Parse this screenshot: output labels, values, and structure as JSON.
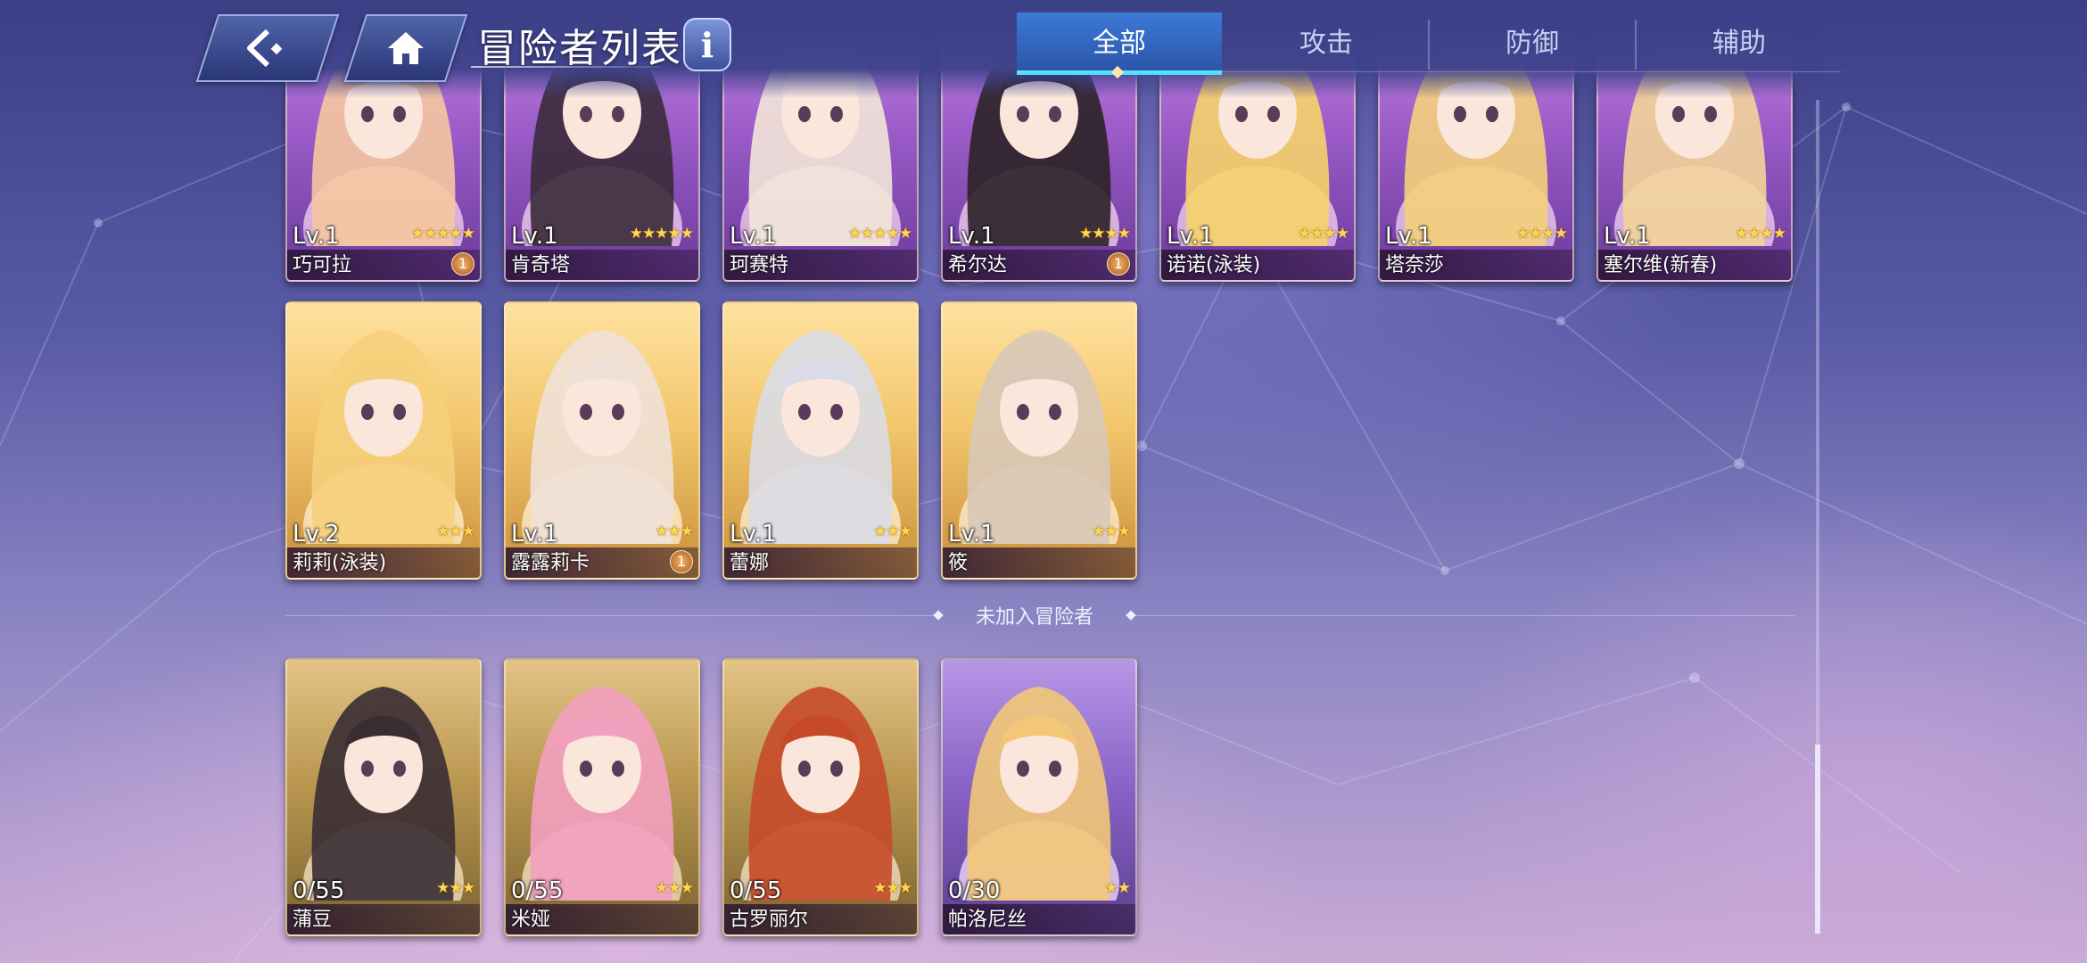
{
  "header": {
    "title": "冒险者列表",
    "info_label": "i",
    "tabs": [
      {
        "label": "全部",
        "active": true
      },
      {
        "label": "攻击",
        "active": false
      },
      {
        "label": "防御",
        "active": false
      },
      {
        "label": "辅助",
        "active": false
      }
    ]
  },
  "joined": [
    {
      "level": "Lv.1",
      "name": "巧可拉",
      "stars": 5,
      "badge": "1",
      "frame": "purple"
    },
    {
      "level": "Lv.1",
      "name": "肯奇塔",
      "stars": 5,
      "badge": "",
      "frame": "purple"
    },
    {
      "level": "Lv.1",
      "name": "珂赛特",
      "stars": 5,
      "badge": "",
      "frame": "purple"
    },
    {
      "level": "Lv.1",
      "name": "希尔达",
      "stars": 4,
      "badge": "1",
      "frame": "purple"
    },
    {
      "level": "Lv.1",
      "name": "诺诺(泳装)",
      "stars": 4,
      "badge": "",
      "frame": "purple"
    },
    {
      "level": "Lv.1",
      "name": "塔奈莎",
      "stars": 4,
      "badge": "",
      "frame": "purple"
    },
    {
      "level": "Lv.1",
      "name": "塞尔维(新春)",
      "stars": 4,
      "badge": "",
      "frame": "purple"
    },
    {
      "level": "Lv.2",
      "name": "莉莉(泳装)",
      "stars": 3,
      "badge": "",
      "frame": "gold"
    },
    {
      "level": "Lv.1",
      "name": "露露莉卡",
      "stars": 3,
      "badge": "1",
      "frame": "gold"
    },
    {
      "level": "Lv.1",
      "name": "蕾娜",
      "stars": 3,
      "badge": "",
      "frame": "gold"
    },
    {
      "level": "Lv.1",
      "name": "筱",
      "stars": 3,
      "badge": "",
      "frame": "gold"
    }
  ],
  "not_joined_label": "未加入冒险者",
  "not_joined": [
    {
      "progress": "0/55",
      "name": "蒲豆",
      "stars": 3,
      "frame": "olive"
    },
    {
      "progress": "0/55",
      "name": "米娅",
      "stars": 3,
      "frame": "olive"
    },
    {
      "progress": "0/55",
      "name": "古罗丽尔",
      "stars": 3,
      "frame": "olive"
    },
    {
      "progress": "0/30",
      "name": "帕洛尼丝",
      "stars": 2,
      "frame": "violet"
    }
  ],
  "colors": {
    "accent_tab": "#3c79d6",
    "tab_underline": "#49e3ff",
    "star": "#ffd651"
  },
  "scroll_position": 0.77
}
